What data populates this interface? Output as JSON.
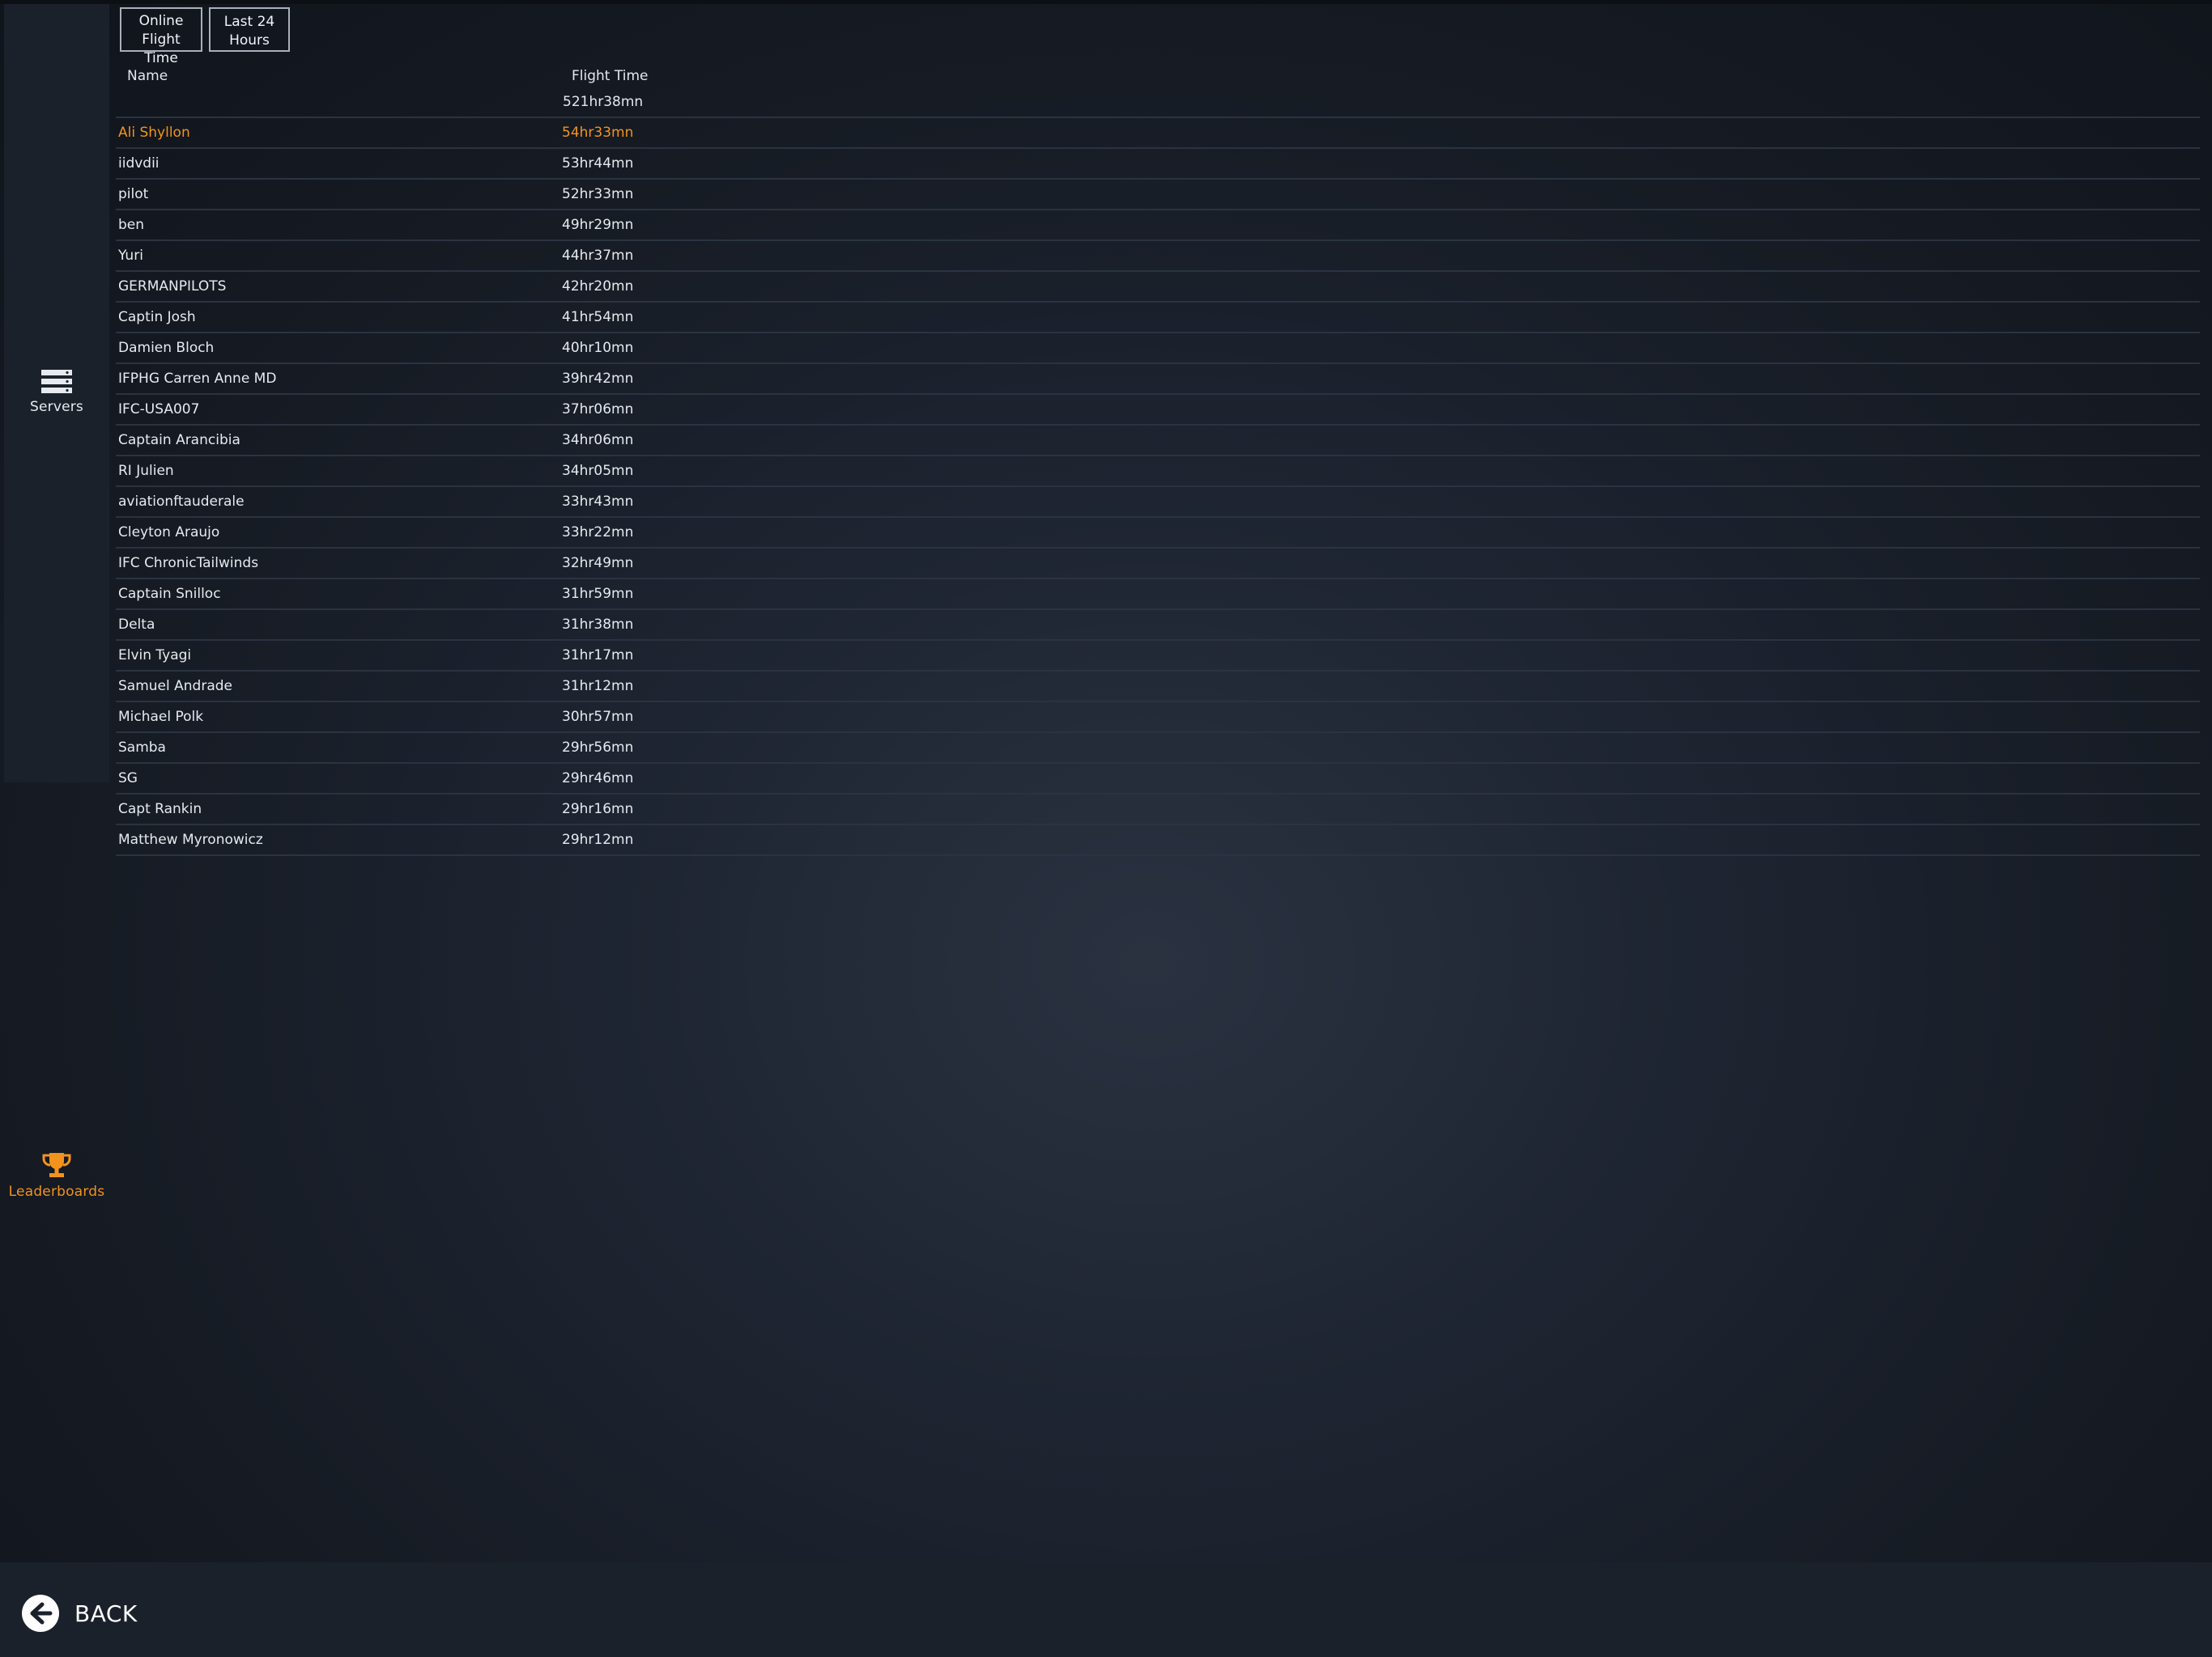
{
  "sidebar": {
    "items": [
      {
        "label": "Servers",
        "icon": "server-icon"
      },
      {
        "label": "Leaderboards",
        "icon": "trophy-icon"
      }
    ]
  },
  "filters": {
    "online_line1": "Online",
    "online_line2": "Flight Time",
    "period_line1": "Last 24",
    "period_line2": "Hours"
  },
  "table": {
    "headers": {
      "name": "Name",
      "flight_time": "Flight Time"
    },
    "total": "521hr38mn",
    "rows": [
      {
        "name": "Ali Shyllon",
        "time": "54hr33mn"
      },
      {
        "name": "iidvdii",
        "time": "53hr44mn"
      },
      {
        "name": "pilot",
        "time": "52hr33mn"
      },
      {
        "name": "ben",
        "time": "49hr29mn"
      },
      {
        "name": "Yuri",
        "time": "44hr37mn"
      },
      {
        "name": "GERMANPILOTS",
        "time": "42hr20mn"
      },
      {
        "name": "Captin Josh",
        "time": "41hr54mn"
      },
      {
        "name": "Damien Bloch",
        "time": "40hr10mn"
      },
      {
        "name": "IFPHG Carren Anne MD",
        "time": "39hr42mn"
      },
      {
        "name": "IFC-USA007",
        "time": "37hr06mn"
      },
      {
        "name": "Captain Arancibia",
        "time": "34hr06mn"
      },
      {
        "name": "RI Julien",
        "time": "34hr05mn"
      },
      {
        "name": "aviationftauderale",
        "time": "33hr43mn"
      },
      {
        "name": "Cleyton Araujo",
        "time": "33hr22mn"
      },
      {
        "name": "IFC ChronicTailwinds",
        "time": "32hr49mn"
      },
      {
        "name": "Captain Snilloc",
        "time": "31hr59mn"
      },
      {
        "name": "Delta",
        "time": "31hr38mn"
      },
      {
        "name": "Elvin Tyagi",
        "time": "31hr17mn"
      },
      {
        "name": "Samuel Andrade",
        "time": "31hr12mn"
      },
      {
        "name": "Michael Polk",
        "time": "30hr57mn"
      },
      {
        "name": "Samba",
        "time": "29hr56mn"
      },
      {
        "name": "SG",
        "time": "29hr46mn"
      },
      {
        "name": "Capt Rankin",
        "time": "29hr16mn"
      },
      {
        "name": "Matthew Myronowicz",
        "time": "29hr12mn"
      }
    ]
  },
  "footer": {
    "back_label": "BACK"
  },
  "colors": {
    "accent": "#f3931c",
    "background": "#1a202a",
    "panel": "#1b212b"
  }
}
